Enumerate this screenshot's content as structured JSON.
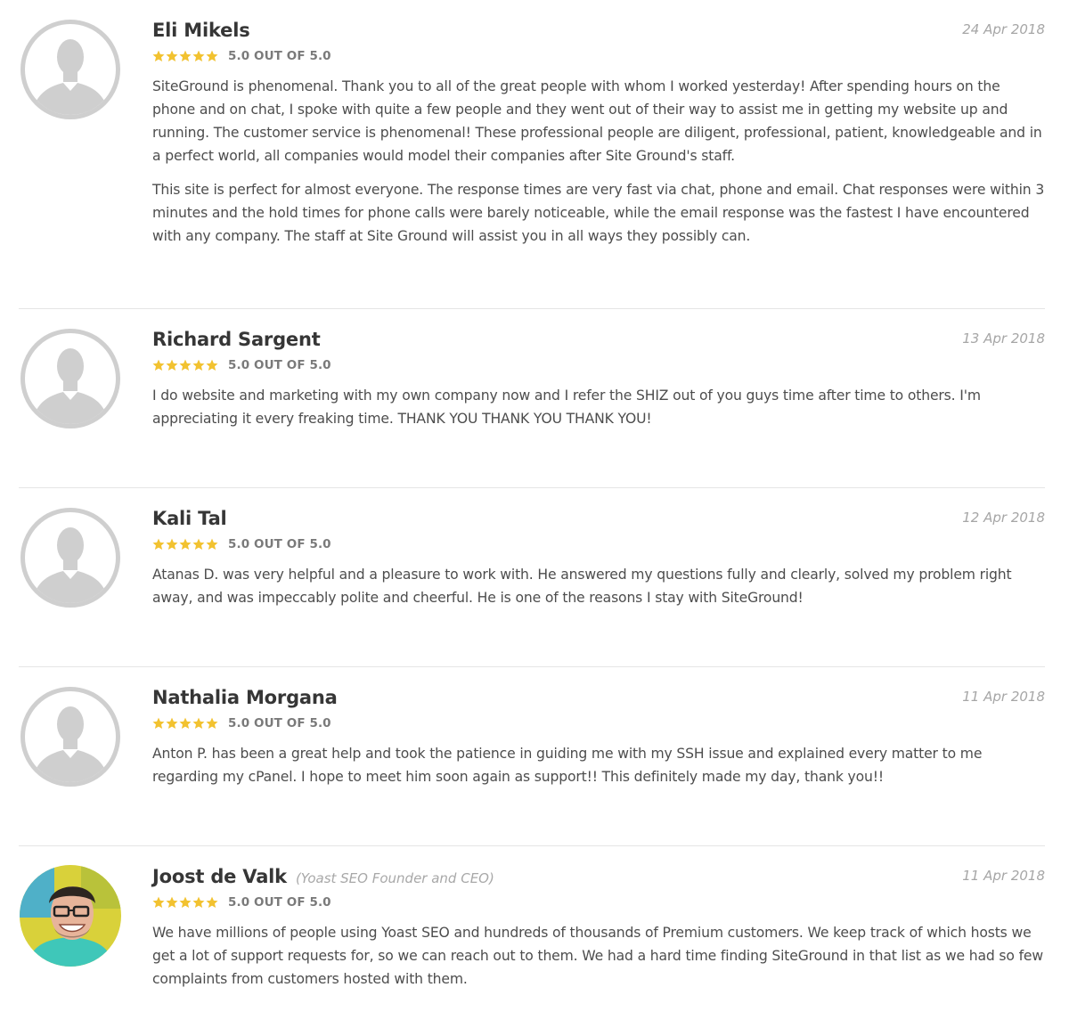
{
  "rating_label": "5.0 OUT OF 5.0",
  "star_color": "#f2c230",
  "reviews": [
    {
      "name": "Eli Mikels",
      "role": "",
      "date": "24 Apr 2018",
      "rating": "5.0 OUT OF 5.0",
      "avatar": "default-avatar-icon",
      "paragraphs": [
        "SiteGround is phenomenal. Thank you to all of the great people with whom I worked yesterday! After spending hours on the phone and on chat, I spoke with quite a few people and they went out of their way to assist me in getting my website up and running. The customer service is phenomenal! These professional people are diligent, professional, patient, knowledgeable and in a perfect world, all companies would model their companies after Site Ground's staff.",
        "This site is perfect for almost everyone. The response times are very fast via chat, phone and email. Chat responses were within 3 minutes and the hold times for phone calls were barely noticeable, while the email response was the fastest I have encountered with any company. The staff at Site Ground will assist you in all ways they possibly can."
      ]
    },
    {
      "name": "Richard Sargent",
      "role": "",
      "date": "13 Apr 2018",
      "rating": "5.0 OUT OF 5.0",
      "avatar": "default-avatar-icon",
      "paragraphs": [
        "I do website and marketing with my own company now and I refer the SHIZ out of you guys time after time to others. I'm appreciating it every freaking time. THANK YOU THANK YOU THANK YOU!"
      ]
    },
    {
      "name": "Kali Tal",
      "role": "",
      "date": "12 Apr 2018",
      "rating": "5.0 OUT OF 5.0",
      "avatar": "default-avatar-icon",
      "paragraphs": [
        "Atanas D. was very helpful and a pleasure to work with. He answered my questions fully and clearly, solved my problem right away, and was impeccably polite and cheerful. He is one of the reasons I stay with SiteGround!"
      ]
    },
    {
      "name": "Nathalia Morgana",
      "role": "",
      "date": "11 Apr 2018",
      "rating": "5.0 OUT OF 5.0",
      "avatar": "default-avatar-icon",
      "paragraphs": [
        "Anton P. has been a great help and took the patience in guiding me with my SSH issue and explained every matter to me regarding my cPanel. I hope to meet him soon again as support!! This definitely made my day, thank you!!"
      ]
    },
    {
      "name": "Joost de Valk",
      "role": "(Yoast SEO Founder and CEO)",
      "date": "11 Apr 2018",
      "rating": "5.0 OUT OF 5.0",
      "avatar": "user-photo-avatar",
      "paragraphs": [
        "We have millions of people using Yoast SEO and hundreds of thousands of Premium customers. We keep track of which hosts we get a lot of support requests for, so we can reach out to them. We had a hard time finding SiteGround in that list as we had so few complaints from customers hosted with them."
      ]
    }
  ]
}
